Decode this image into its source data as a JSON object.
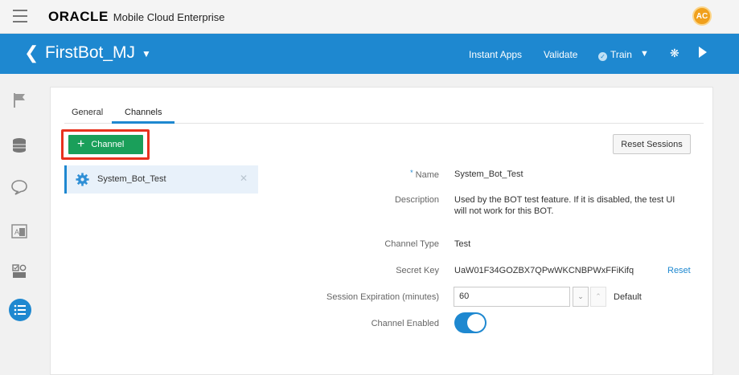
{
  "topbar": {
    "brand": "ORACLE",
    "product": "Mobile Cloud Enterprise",
    "avatar_initials": "AC"
  },
  "header": {
    "bot_name": "FirstBot_MJ",
    "instant_apps": "Instant Apps",
    "validate": "Validate",
    "train": "Train"
  },
  "tabs": [
    {
      "label": "General"
    },
    {
      "label": "Channels"
    }
  ],
  "toolbar": {
    "add_channel_label": "Channel",
    "reset_sessions_label": "Reset Sessions"
  },
  "channels": [
    {
      "name": "System_Bot_Test"
    }
  ],
  "details": {
    "name_label": "Name",
    "name_value": "System_Bot_Test",
    "description_label": "Description",
    "description_line1": "Used by the BOT test feature. If it is disabled, the test UI",
    "description_line2": "will not work for this BOT.",
    "channel_type_label": "Channel Type",
    "channel_type_value": "Test",
    "secret_key_label": "Secret Key",
    "secret_key_value": "UaW01F34GOZBX7QPwWKCNBPWxFFiKifq",
    "reset_label": "Reset",
    "session_expiration_label": "Session Expiration (minutes)",
    "session_expiration_value": "60",
    "default_label": "Default",
    "channel_enabled_label": "Channel Enabled",
    "channel_enabled": true
  },
  "colors": {
    "brand_blue": "#1e88d0",
    "add_green": "#1a9f5a",
    "highlight_red": "#e8321e"
  }
}
